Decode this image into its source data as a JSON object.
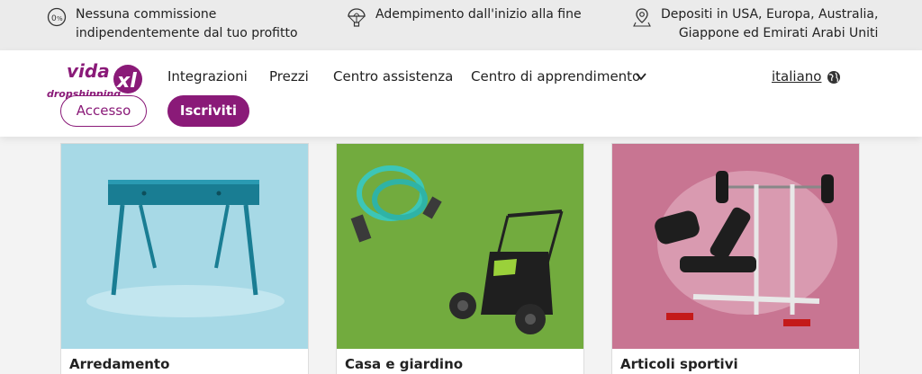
{
  "usp_bar": {
    "items": [
      {
        "icon": "zero-percent-icon",
        "lines": [
          "Nessuna commissione",
          "indipendentemente dal tuo profitto"
        ]
      },
      {
        "icon": "parachute-icon",
        "lines": [
          "Adempimento dall'inizio alla fine"
        ]
      },
      {
        "icon": "location-pin-icon",
        "lines": [
          "Depositi in USA, Europa, Australia,",
          "Giappone ed Emirati Arabi Uniti"
        ]
      }
    ]
  },
  "header": {
    "logo_text": "vidaXL dropshipping",
    "nav": [
      "Integrazioni",
      "Prezzi",
      "Centro assistenza",
      "Centro di apprendimento"
    ],
    "language": "italiano",
    "login_label": "Accesso",
    "signup_label": "Iscriviti"
  },
  "categories": [
    {
      "label": "Arredamento",
      "image": "desk-image",
      "bg": "#9fd3e0"
    },
    {
      "label": "Casa e giardino",
      "image": "garden-hose-sweeper-image",
      "bg": "#6fa83c"
    },
    {
      "label": "Articoli sportivi",
      "image": "weight-bench-image",
      "bg": "#c9728f"
    }
  ],
  "colors": {
    "brand": "#8a1a78",
    "topbar": "#ebebeb"
  }
}
